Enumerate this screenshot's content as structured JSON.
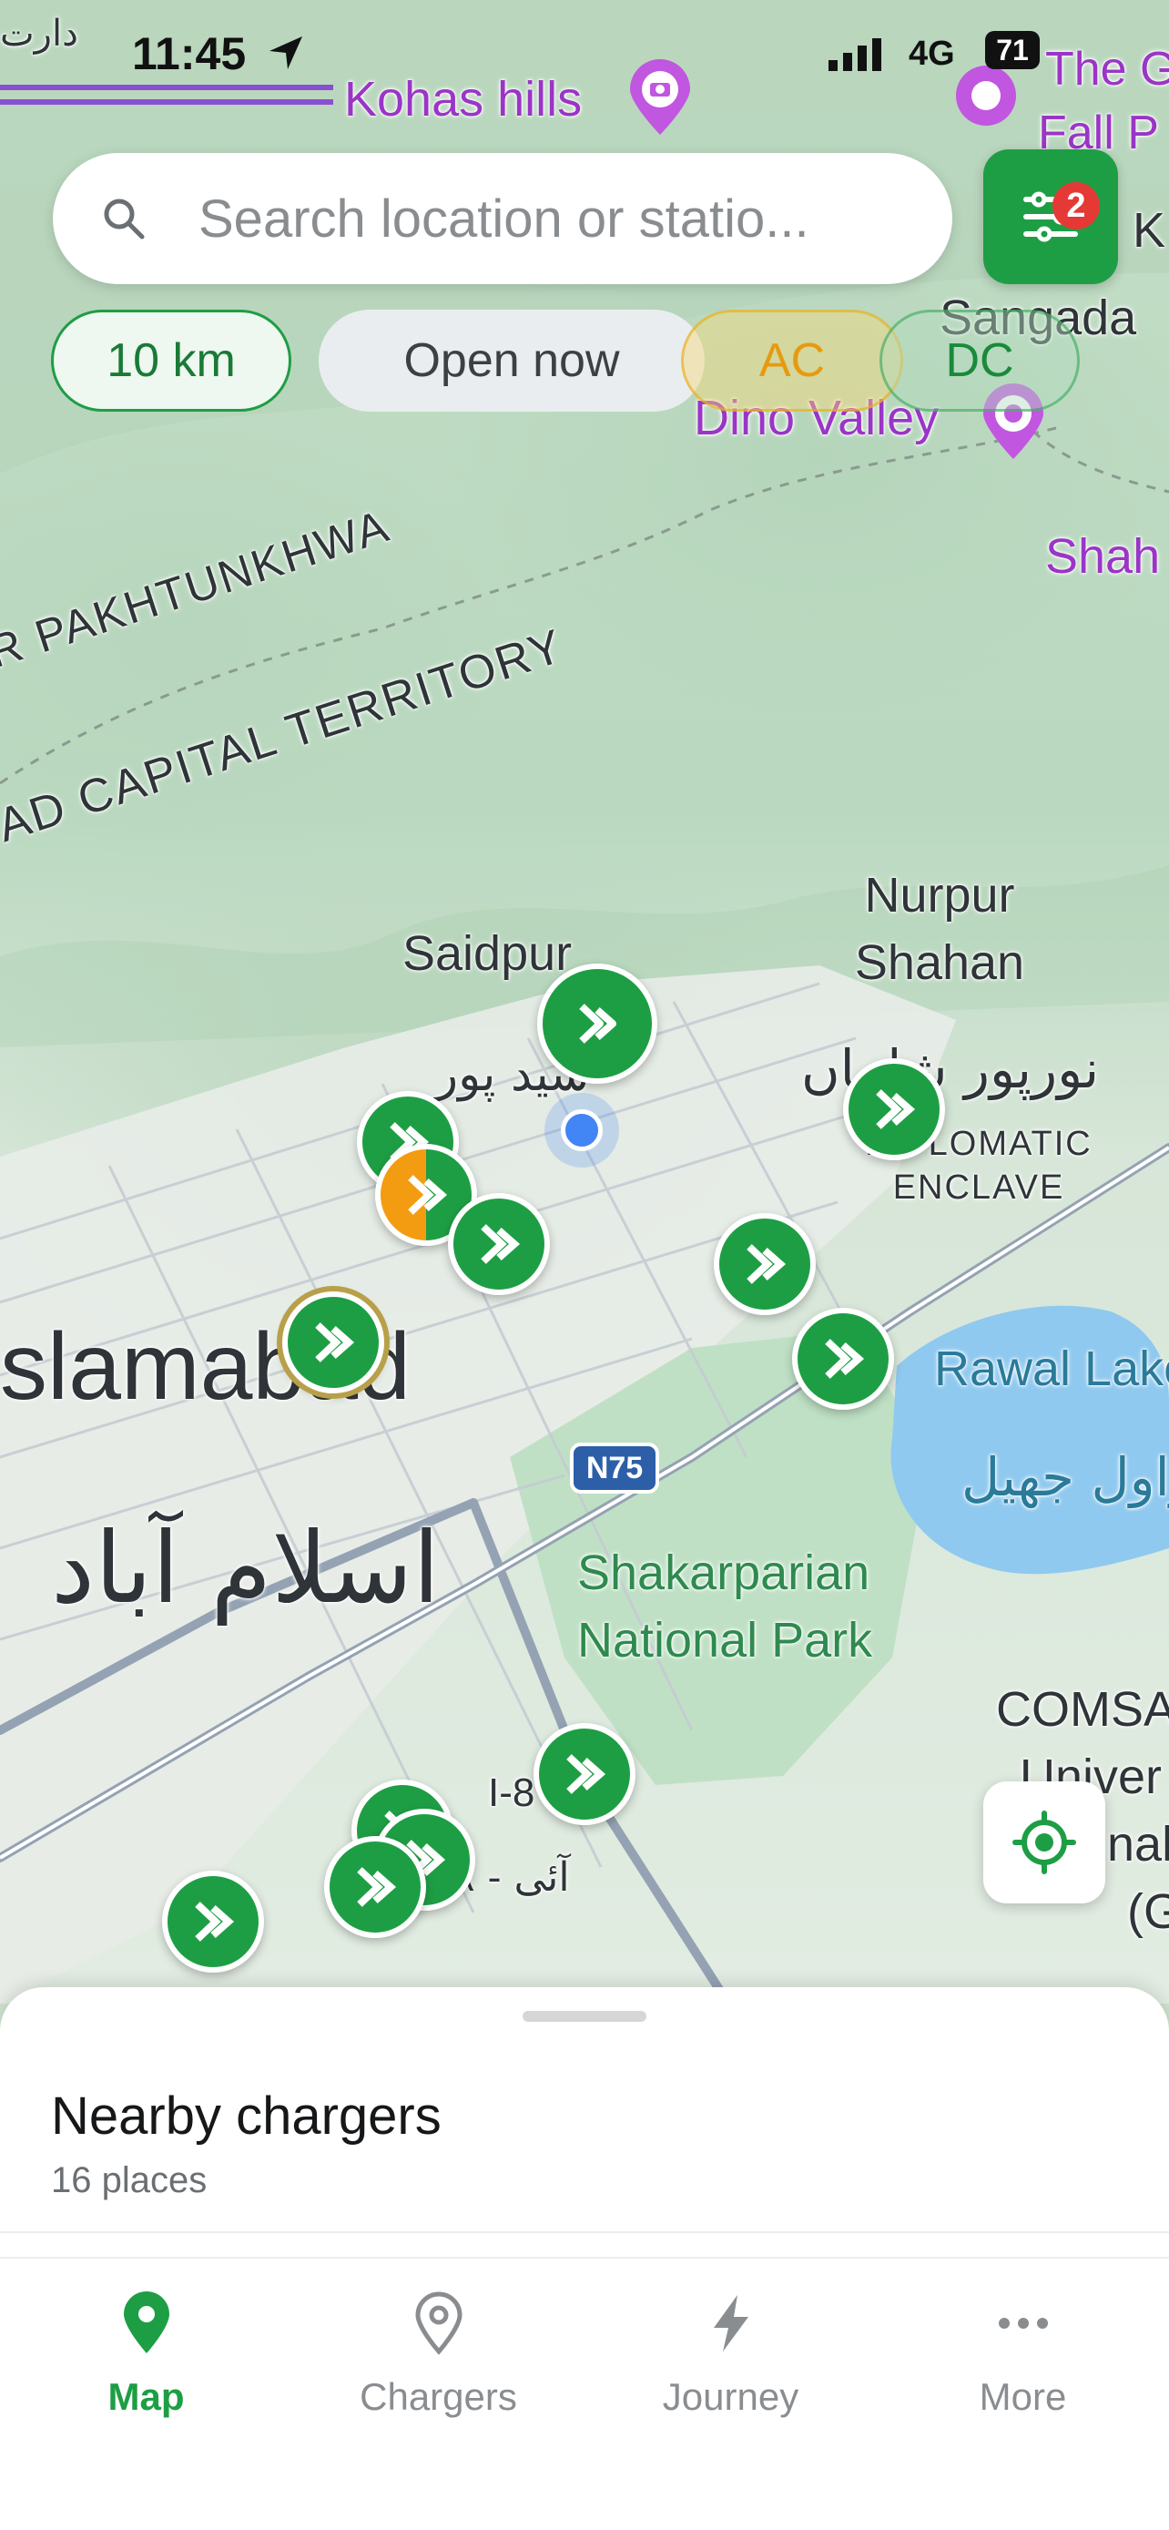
{
  "status_bar": {
    "time": "11:45",
    "network": "4G",
    "battery": "71"
  },
  "search": {
    "placeholder": "Search location or statio..."
  },
  "filter_button": {
    "badge_count": "2"
  },
  "chips": {
    "distance": "10 km",
    "open_now": "Open now",
    "ac": "AC",
    "dc": "DC"
  },
  "map_labels": {
    "kohas_hills": "Kohas hills",
    "the_g_fall": "The G",
    "fall_p": "Fall P",
    "k": "K",
    "sangada": "Sangada",
    "dino_valley": "Dino Valley",
    "shah": "Shah",
    "province1": "R PAKHTUNKHWA",
    "province2": "AD CAPITAL TERRITORY",
    "nurpur_shahan": "Nurpur Shahan",
    "nurpur_urdu": "نورپور شاہاں",
    "saidpur": "Saidpur",
    "saidpur_urdu": "سید پور",
    "diplomatic_enclave": "DIPLOMATIC ENCLAVE",
    "islamabad": "slamabad",
    "islamabad_urdu": "اسلام آباد",
    "rawal_lake": "Rawal Lake",
    "rawal_urdu": "راول جھیل",
    "n75": "N75",
    "shakarparian": "Shakarparian National Park",
    "comsats": "COMSA",
    "univer": "Univer",
    "nal": "nal",
    "g": "(G",
    "i8": "I-8",
    "i8_urdu": "آئی - ۸",
    "top_left_urdu": "دارت"
  },
  "sheet": {
    "title": "Nearby chargers",
    "count": "16 places"
  },
  "tabs": [
    {
      "label": "Map",
      "icon": "map-pin-icon",
      "active": true
    },
    {
      "label": "Chargers",
      "icon": "location-outline-icon",
      "active": false
    },
    {
      "label": "Journey",
      "icon": "lightning-icon",
      "active": false
    },
    {
      "label": "More",
      "icon": "more-dots-icon",
      "active": false
    }
  ],
  "colors": {
    "brand_green": "#1e9e44",
    "ac_orange": "#e69a10",
    "badge_red": "#e53935",
    "purple_poi": "#9a35c6"
  }
}
